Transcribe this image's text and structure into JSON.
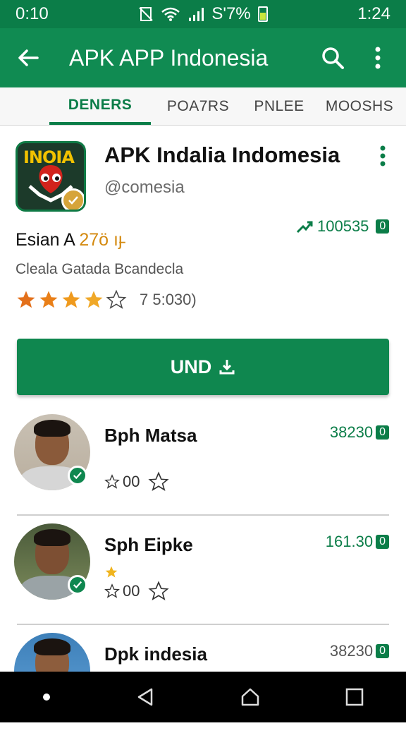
{
  "status": {
    "time_left": "0:10",
    "battery_text": "S'7%",
    "time_right": "1:24"
  },
  "appbar": {
    "title": "APK APP Indonesia"
  },
  "tabs": [
    {
      "label": "DENERS",
      "active": true
    },
    {
      "label": "POA7RS",
      "active": false
    },
    {
      "label": "PNLEE",
      "active": false
    },
    {
      "label": "MOOSHS",
      "active": false
    }
  ],
  "app": {
    "logo_text": "INOIA",
    "name": "APK Indalia Indomesia",
    "handle": "@comesia",
    "downloads": "100535",
    "downloads_badge": "0",
    "meta_prefix": "Esian A",
    "meta_value": "27ö",
    "meta_suffix": "ıȷ̵",
    "description": "Cleala Gatada Bcandecla",
    "rating_stars": 4,
    "rating_count": "7 5:030)",
    "install_label": "UND"
  },
  "reviews": [
    {
      "name": "Bph Matsa",
      "count": "38230",
      "badge": "0",
      "stars": "00",
      "highlight": true,
      "gold_star": false
    },
    {
      "name": "Sph Eipke",
      "count": "161.30",
      "badge": "0",
      "stars": "00",
      "highlight": true,
      "gold_star": true
    },
    {
      "name": "Dpk indesia",
      "count": "38230",
      "badge": "0",
      "stars": "",
      "highlight": false,
      "gold_star": false
    }
  ],
  "colors": {
    "primary": "#108b52",
    "primary_dark": "#0b7d48",
    "star_orange": "#e3701b",
    "star_gold": "#f0a020"
  }
}
